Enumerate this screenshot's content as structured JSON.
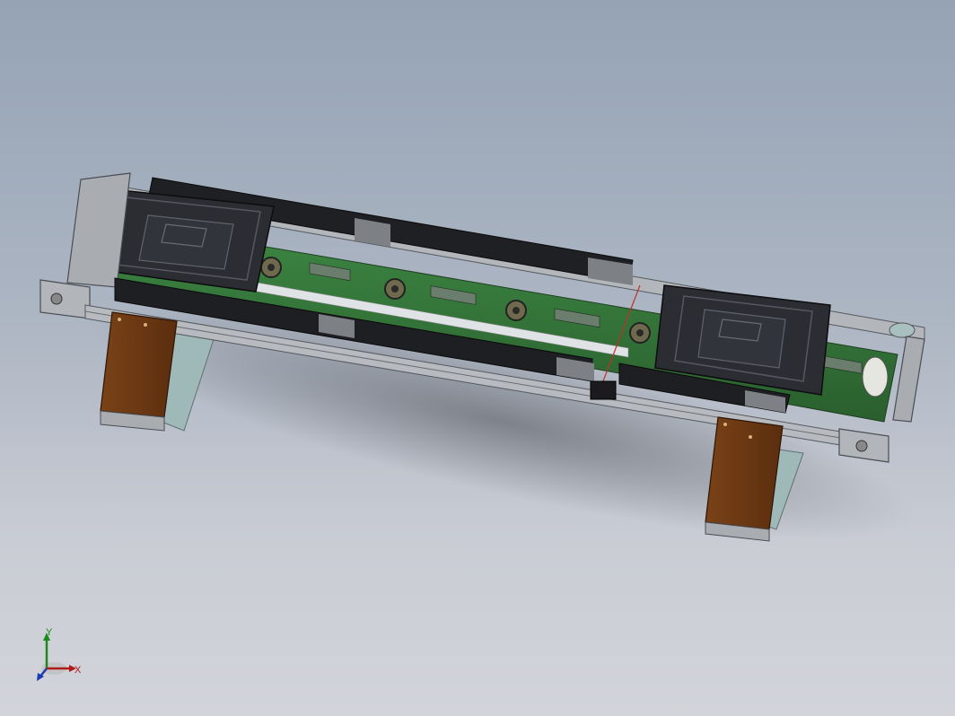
{
  "viewport": {
    "background_top": "#95a3b5",
    "background_bottom": "#d2d4da"
  },
  "model": {
    "colors": {
      "frame": "#a3a7ab",
      "frame_dark": "#5d6166",
      "belt": "#2d6b32",
      "belt_light": "#3f8a44",
      "cover": "#202125",
      "fixture_plate": "#2b2d33",
      "leg": "#6a3712",
      "leg_light": "#8a4b1d",
      "roller": "#6f6a4e",
      "glass": "#a8c0c0"
    },
    "parts": [
      "conveyor-frame",
      "belt",
      "fixture-left",
      "fixture-right",
      "side-cover-front",
      "side-cover-back",
      "legs",
      "rollers"
    ]
  },
  "triad": {
    "x_label": "X",
    "y_label": "Y",
    "x_color": "#b01a1a",
    "y_color": "#1a8a1a",
    "z_color": "#1a3ab0"
  }
}
